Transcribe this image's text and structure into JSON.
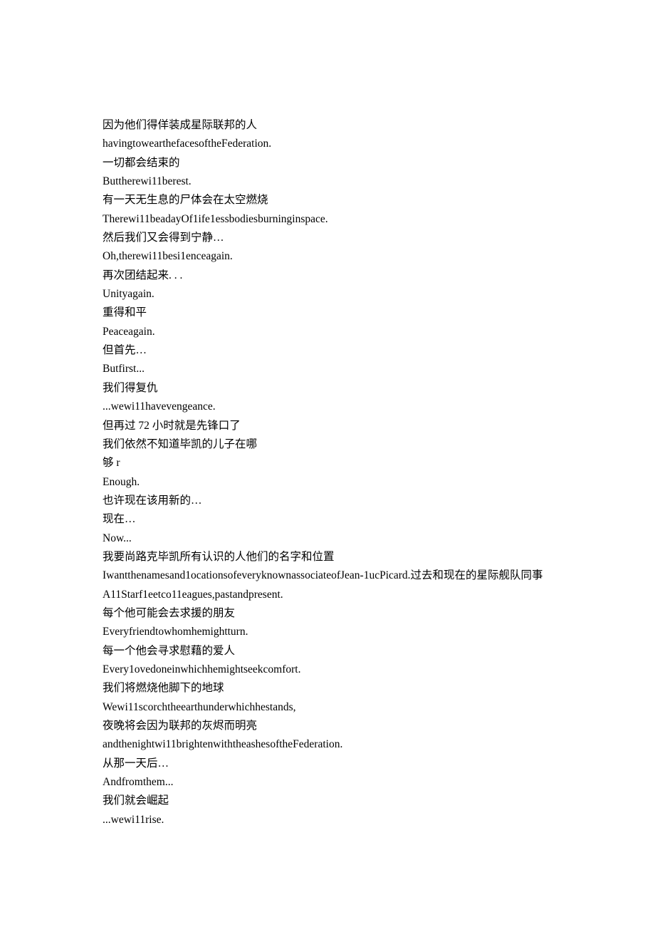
{
  "lines": [
    "因为他们得佯装成星际联邦的人",
    "havingtowearthefacesoftheFederation.",
    "一切都会结束的",
    "Buttherewi11berest.",
    "有一天无生息的尸体会在太空燃烧",
    "Therewi11beadayOf1ife1essbodiesburninginspace.",
    "然后我们又会得到宁静…",
    "Oh,therewi11besi1enceagain.",
    "再次团结起来. . .",
    "Unityagain.",
    "重得和平",
    "Peaceagain.",
    "但首先…",
    "Butfirst...",
    "我们得复仇",
    "...wewi11havevengeance.",
    "但再过 72 小时就是先锋口了",
    "我们依然不知道毕凯的儿子在哪",
    "够 r",
    "Enough.",
    "也许现在该用新的…",
    "现在…",
    "Now...",
    "我要尚路克毕凯所有认识的人他们的名字和位置",
    "Iwantthenamesand1ocationsofeveryknownassociateofJean-1ucPicard.过去和现在的星际舰队同事",
    "A11Starf1eetco11eagues,pastandpresent.",
    "每个他可能会去求援的朋友",
    "Everyfriendtowhomhemightturn.",
    "每一个他会寻求慰藉的爱人",
    "Every1ovedoneinwhichhemightseekcomfort.",
    "我们将燃烧他脚下的地球",
    "Wewi11scorchtheearthunderwhichhestands,",
    "夜晚将会因为联邦的灰烬而明亮",
    "andthenightwi11brightenwiththeashesoftheFederation.",
    "从那一天后…",
    "Andfromthem...",
    "我们就会崛起",
    "...wewi11rise."
  ]
}
